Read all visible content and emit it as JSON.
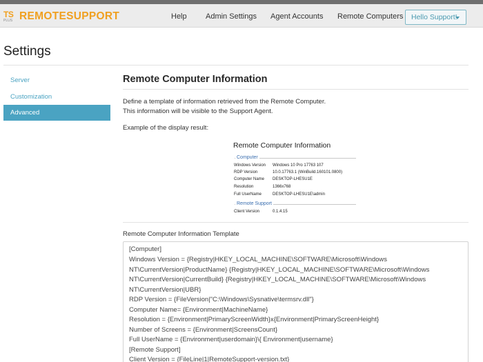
{
  "navbar": {
    "logo_mark_text": "TS",
    "logo_mark_subtext": "PLUS",
    "logo_part1": "REMOTE",
    "logo_part2": "SUPPORT",
    "items": [
      {
        "label": "Help"
      },
      {
        "label": "Admin Settings"
      },
      {
        "label": "Agent Accounts"
      },
      {
        "label": "Remote Computers"
      }
    ],
    "user_button": "Hello Support!"
  },
  "page": {
    "title": "Settings"
  },
  "sidebar": {
    "items": [
      {
        "label": "Server",
        "active": false
      },
      {
        "label": "Customization",
        "active": false
      },
      {
        "label": "Advanced",
        "active": true
      }
    ]
  },
  "section": {
    "title": "Remote Computer Information",
    "description_line1": "Define a template of information retrieved from the Remote Computer.",
    "description_line2": "This information will be visible to the Support Agent.",
    "example_label": "Example of the display result:"
  },
  "example": {
    "title": "Remote Computer Information",
    "computer_group": "Computer",
    "rows": [
      {
        "key": "Windows Version",
        "value": "Windows 10 Pro 17763 107"
      },
      {
        "key": "RDP Version",
        "value": "10.0.17763.1 (WinBuild.160101.0800)"
      },
      {
        "key": "Computer Name",
        "value": "DESKTOP-LHESU1E"
      },
      {
        "key": "Resolution",
        "value": "1366x768"
      },
      {
        "key": "Full UserName",
        "value": "DESKTOP-LHESU1E\\admin"
      }
    ],
    "remote_group": "Remote Support",
    "remote_rows": [
      {
        "key": "Client Version",
        "value": "0.1.4.15"
      }
    ]
  },
  "template": {
    "label": "Remote Computer Information Template",
    "lines": [
      "[Computer]",
      "Windows Version = {Registry|HKEY_LOCAL_MACHINE\\SOFTWARE\\Microsoft\\Windows",
      "NT\\CurrentVersion|ProductName} {Registry|HKEY_LOCAL_MACHINE\\SOFTWARE\\Microsoft\\Windows",
      "NT\\CurrentVersion|CurrentBuild} {Registry|HKEY_LOCAL_MACHINE\\SOFTWARE\\Microsoft\\Windows",
      "NT\\CurrentVersion|UBR}",
      "RDP Version = {FileVersion|\"C:\\Windows\\Sysnative\\termsrv.dll\"}",
      "Computer Name= {Environment|MachineName}",
      "Resolution = {Environment|PrimaryScreenWidth}x{Environment|PrimaryScreenHeight}",
      "Number of Screens = {Environment|ScreensCount}",
      "Full UserName = {Environment|userdomain}\\{ Environment|username}",
      "[Remote Support]",
      "Client Version = {FileLine|1|RemoteSupport-version.txt}"
    ]
  },
  "colors": {
    "accent": "#4aa3c2",
    "logo_orange": "#f0a020",
    "navbar_bg": "#ececec"
  }
}
